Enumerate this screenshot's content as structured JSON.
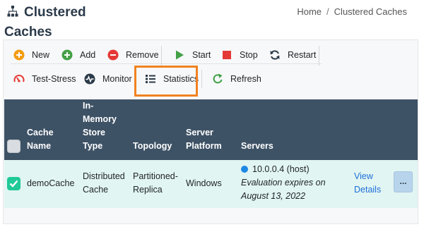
{
  "header": {
    "title": "Clustered Caches",
    "breadcrumb": {
      "home": "Home",
      "separator": "/",
      "current": "Clustered Caches"
    }
  },
  "toolbar": {
    "new": "New",
    "add": "Add",
    "remove": "Remove",
    "start": "Start",
    "stop": "Stop",
    "restart": "Restart",
    "test_stress": "Test-Stress",
    "monitor": "Monitor",
    "statistics": "Statistics",
    "refresh": "Refresh"
  },
  "table": {
    "columns": {
      "cache_name": [
        "Cache",
        "Name"
      ],
      "store_type": [
        "In-",
        "Memory",
        "Store",
        "Type"
      ],
      "topology": "Topology",
      "server_platform": [
        "Server",
        "Platform"
      ],
      "servers": "Servers"
    },
    "rows": [
      {
        "name": "demoCache",
        "store_type": [
          "Distributed",
          "Cache"
        ],
        "topology": [
          "Partitioned-",
          "Replica"
        ],
        "platform": "Windows",
        "server": "10.0.0.4 (host)",
        "note": [
          "Evaluation expires on",
          "August 13, 2022"
        ],
        "view": [
          "View",
          "Details"
        ],
        "more": "..."
      }
    ]
  },
  "colors": {
    "header_bg": "#3e5266",
    "row_bg": "#e1f5f2",
    "highlight": "#f18221",
    "link": "#1e6fd9",
    "checkbox_checked": "#20c997"
  }
}
